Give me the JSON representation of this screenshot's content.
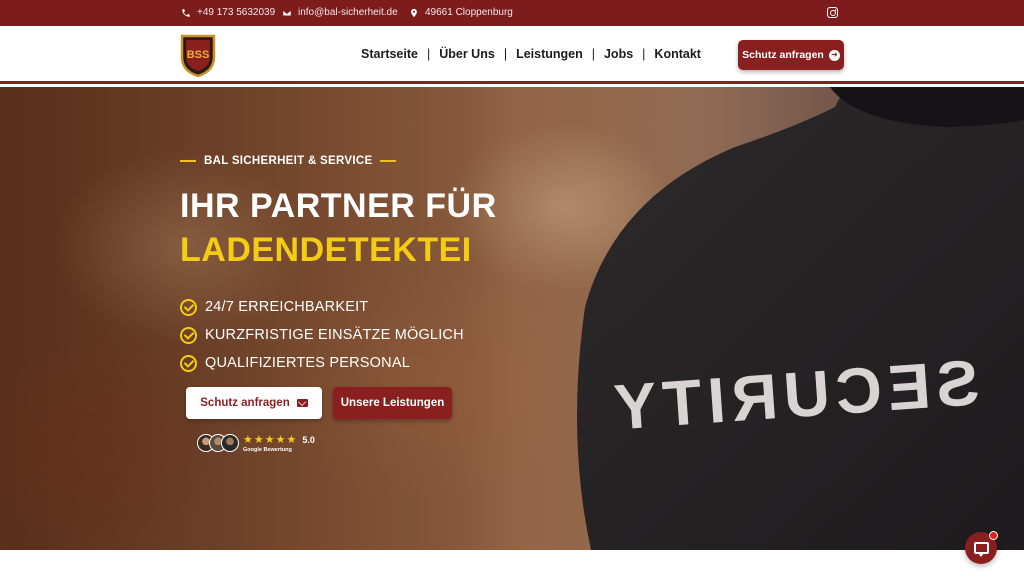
{
  "topbar": {
    "phone": "+49 173 5632039",
    "email": "info@bal-sicherheit.de",
    "location": "49661 Cloppenburg",
    "social_icon": "instagram-icon"
  },
  "header": {
    "logo_text": "BSS",
    "nav": [
      {
        "label": "Startseite"
      },
      {
        "label": "Über Uns"
      },
      {
        "label": "Leistungen"
      },
      {
        "label": "Jobs"
      },
      {
        "label": "Kontakt"
      }
    ],
    "cta_label": "Schutz anfragen"
  },
  "hero": {
    "eyebrow": "BAL SICHERHEIT & SERVICE",
    "headline_line1": "IHR PARTNER FÜR",
    "headline_line2": "LADENDETEKTEI",
    "features": [
      {
        "label": "24/7 ERREICHBARKEIT"
      },
      {
        "label": "KURZFRISTIGE EINSÄTZE MÖGLICH"
      },
      {
        "label": "QUALIFIZIERTES PERSONAL"
      }
    ],
    "primary_button": "Schutz anfragen",
    "secondary_button": "Unsere Leistungen",
    "shirt_text": "SECURITY",
    "reviews": {
      "stars": "★★★★★",
      "score": "5.0",
      "source": "Google Bewertung"
    }
  },
  "colors": {
    "brand_red": "#8a1f1f",
    "topbar_red": "#7d1c1c",
    "accent_yellow": "#f5cc14"
  }
}
